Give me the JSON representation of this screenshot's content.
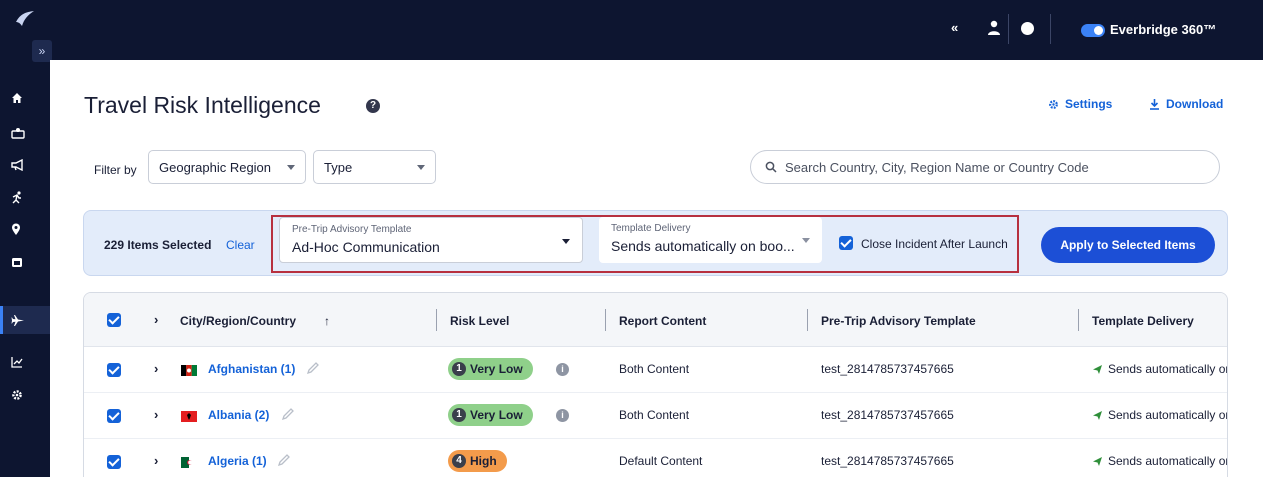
{
  "topbar": {
    "collapse_glyph": "«",
    "brand": "Everbridge 360™",
    "icons": [
      "collapse-icon",
      "user-icon",
      "help-icon",
      "toggle-switch"
    ]
  },
  "sidebar": {
    "expand_glyph": "»",
    "items": [
      {
        "icon": "home-icon"
      },
      {
        "icon": "people-icon"
      },
      {
        "icon": "megaphone-icon"
      },
      {
        "icon": "run-icon"
      },
      {
        "icon": "location-icon"
      },
      {
        "icon": "calendar-icon"
      },
      {
        "icon": "airplane-icon",
        "active": true
      },
      {
        "icon": "chart-icon"
      },
      {
        "icon": "gear-icon"
      }
    ]
  },
  "page": {
    "title": "Travel Risk Intelligence",
    "help_glyph": "?",
    "settings_label": "Settings",
    "download_label": "Download"
  },
  "filters": {
    "label": "Filter by",
    "region_label": "Geographic Region",
    "type_label": "Type",
    "search_placeholder": "Search Country, City, Region Name or Country Code"
  },
  "bulk": {
    "selected_count": "229 Items Selected",
    "clear_label": "Clear",
    "template_label": "Pre-Trip Advisory Template",
    "template_value": "Ad-Hoc Communication",
    "delivery_label": "Template Delivery",
    "delivery_value": "Sends automatically on boo...",
    "close_incident_label": "Close Incident After Launch",
    "close_incident_checked": true,
    "apply_label": "Apply to Selected Items"
  },
  "table": {
    "headers": [
      "City/Region/Country",
      "Risk Level",
      "Report Content",
      "Pre-Trip Advisory Template",
      "Template Delivery"
    ],
    "sort_glyph": "↑",
    "rows": [
      {
        "country": "Afghanistan (1)",
        "risk_num": "1",
        "risk": "Very Low",
        "risk_color": "#8fd08a",
        "content": "Both Content",
        "template": "test_2814785737457665",
        "delivery": "Sends automatically or"
      },
      {
        "country": "Albania (2)",
        "risk_num": "1",
        "risk": "Very Low",
        "risk_color": "#8fd08a",
        "content": "Both Content",
        "template": "test_2814785737457665",
        "delivery": "Sends automatically or"
      },
      {
        "country": "Algeria (1)",
        "risk_num": "4",
        "risk": "High",
        "risk_color": "#f39b4b",
        "content": "Default Content",
        "template": "test_2814785737457665",
        "delivery": "Sends automatically or"
      }
    ]
  },
  "colors": {
    "nav_bg": "#0d1530",
    "accent": "#1462d8",
    "highlight_border": "#b7303f"
  }
}
